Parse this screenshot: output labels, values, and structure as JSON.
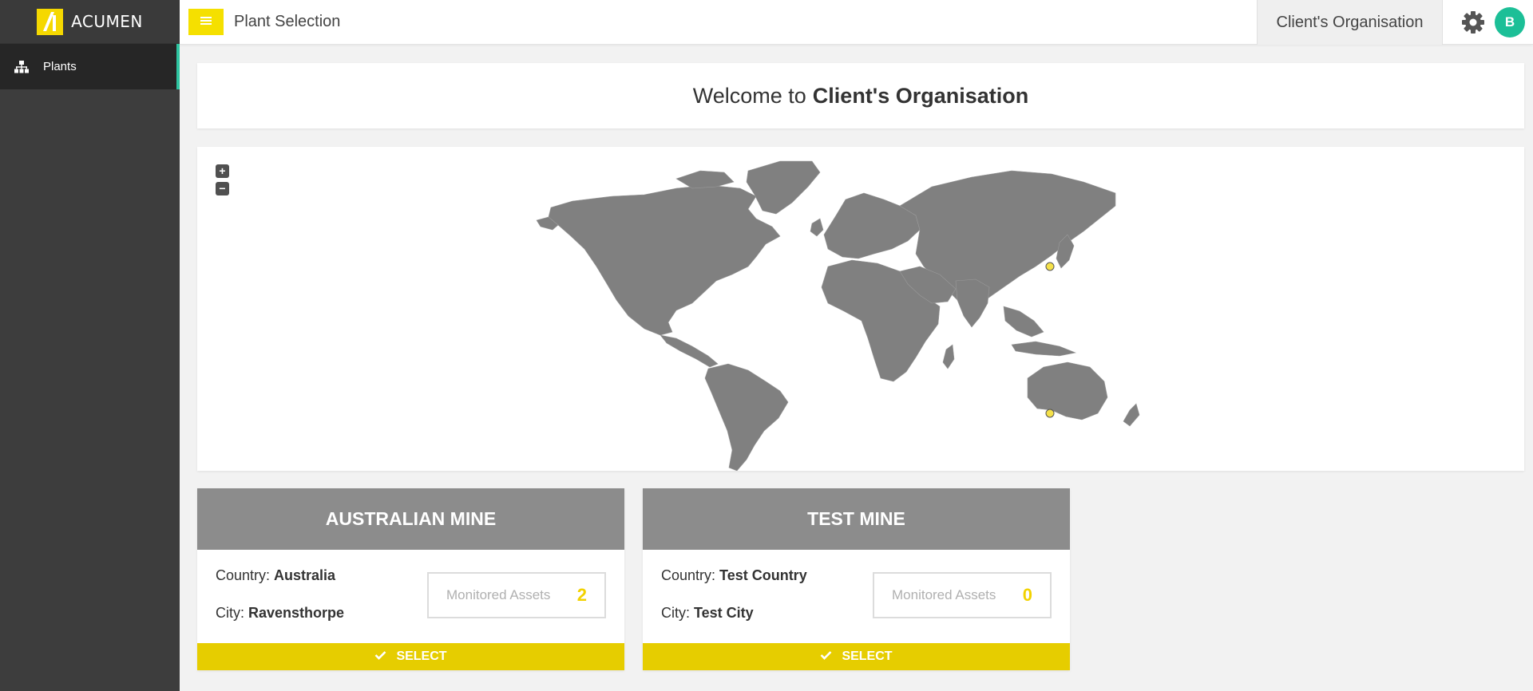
{
  "brand": {
    "name": "ACUMEN",
    "accent": "#f5d800"
  },
  "sidebar": {
    "items": [
      {
        "label": "Plants",
        "icon": "sitemap-icon"
      }
    ]
  },
  "header": {
    "title": "Plant Selection",
    "organisation": "Client's Organisation",
    "avatar_initial": "B"
  },
  "welcome": {
    "prefix": "Welcome to",
    "org": "Client's Organisation"
  },
  "map": {
    "zoom_in": "+",
    "zoom_out": "−",
    "markers": [
      {
        "name": "East Asia site"
      },
      {
        "name": "Ravensthorpe, Australia"
      }
    ]
  },
  "cards": [
    {
      "title": "AUSTRALIAN MINE",
      "country_label": "Country:",
      "country": "Australia",
      "city_label": "City:",
      "city": "Ravensthorpe",
      "assets_label": "Monitored Assets",
      "assets_value": "2",
      "select_label": "SELECT"
    },
    {
      "title": "TEST MINE",
      "country_label": "Country:",
      "country": "Test Country",
      "city_label": "City:",
      "city": "Test City",
      "assets_label": "Monitored Assets",
      "assets_value": "0",
      "select_label": "SELECT"
    }
  ]
}
